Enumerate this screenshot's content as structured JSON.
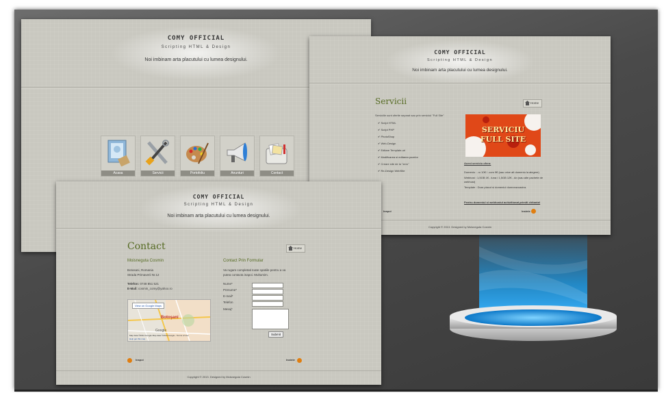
{
  "site": {
    "title": "COMY OFFICIAL",
    "subtitle": "Scripting HTML & Design",
    "tagline": "Noi imbinam arta placutului cu lumea designului.",
    "copyright": "Copyright © 2013. Designed by Moisneguta Cosmin"
  },
  "home": {
    "menu": [
      {
        "label": "Acasa",
        "icon": "picture-frame-icon"
      },
      {
        "label": "Servicii",
        "icon": "tools-icon"
      },
      {
        "label": "Portofoliu",
        "icon": "palette-icon"
      },
      {
        "label": "Anunturi",
        "icon": "megaphone-icon"
      },
      {
        "label": "Contact",
        "icon": "mailbox-icon"
      }
    ]
  },
  "services": {
    "heading": "Servicii",
    "home_button": "Home",
    "intro": "Serviciile sunt oferite separat sau prin serviciul \"Full Site\"",
    "items": [
      "Script HTML",
      "Script PHP",
      "PhotoShop",
      "Web-Design",
      "Editare Template-uri",
      "Modificarea si editarea pozelor",
      "Creare site de la \"zero\"",
      "Re-Design WebSite"
    ],
    "banner_line1": "SERVICIU",
    "banner_line2": "FULL SITE",
    "offer_title": "Acest serviciu ofera:",
    "offer_lines": [
      "Domeniu : .ro 10€ / .com 9€ (sau orice alt domeniu la alegere)",
      "Webhost : 1,5GB 1€ - luna / 1,5GB 12€ - An (sau alte pachete de webhost)",
      "Template : Doar placut si domeniul dumneavoastra."
    ],
    "offer_note": "Pentru domeniul si webhostul achizitionat primiti chitanta!",
    "back": "Inapoi",
    "next": "Inainte"
  },
  "contact": {
    "heading": "Contact",
    "home_button": "Home",
    "name": "Moisneguta Cosmin",
    "address_lines": [
      "Botosani, Romania",
      "Strada Primaverii Nr.12"
    ],
    "phone_label": "Telefon:",
    "phone": "0748 851 521",
    "email_label": "E-Mail:",
    "email": "cosmin_comy@yahoo.ro",
    "map_link": "View on Google Maps",
    "map_city": "Botoşani",
    "map_google": "Google",
    "map_footer": "Map data ©2014 Google  Map data ©2014 Google  -  Terms of Use",
    "map_report": "Help get this map",
    "form_title": "Contact Prin Formular",
    "form_intro": "Va rugam completati toate spatiile pentru a va putea contacta inapoi. Multumim.",
    "fields": [
      "Nume*",
      "Prenume*",
      "E-mail*",
      "Telefon",
      "Mesaj*"
    ],
    "submit": "Submit",
    "back": "Inapoi",
    "next": "Inainte"
  }
}
